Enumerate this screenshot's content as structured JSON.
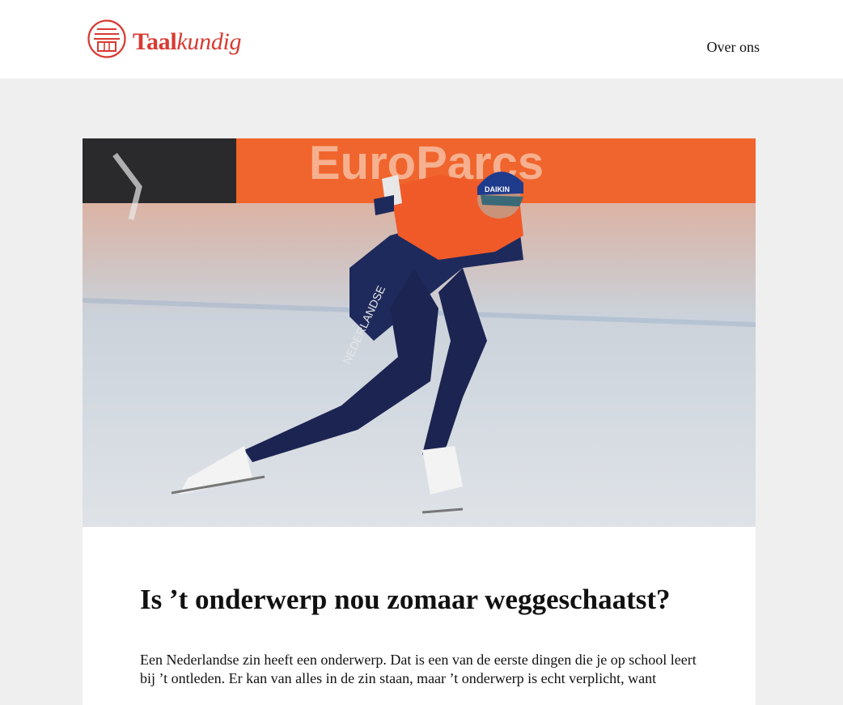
{
  "site": {
    "logo_bold": "Taal",
    "logo_italic": "kundig",
    "brand_color": "#d93a33",
    "logo_icon": "building-icon"
  },
  "nav": {
    "about_label": "Over ons"
  },
  "article": {
    "hero_image": {
      "icon": "speed-skater-photo",
      "banner_text": "EuroParcs",
      "suit_text": "NEDERLANDSE",
      "cap_text": "DAIKIN"
    },
    "title": "Is ’t onderwerp nou zomaar weggeschaatst?",
    "body": "Een Nederlandse zin heeft een onderwerp. Dat is een van de eerste dingen die je op school leert bij ’t ontleden. Er kan van alles in de zin staan, maar ’t onderwerp is echt verplicht, want"
  }
}
